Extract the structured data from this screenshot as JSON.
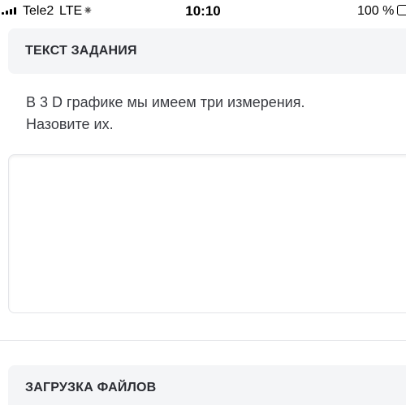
{
  "status_bar": {
    "carrier": "Tele2",
    "network": "LTE",
    "loading_glyph": "⁕",
    "time": "10:10",
    "battery": "100 %"
  },
  "task_section": {
    "header": "ТЕКСТ ЗАДАНИЯ",
    "line1": "В 3 D графике мы имеем три измерения.",
    "line2": "Назовите их."
  },
  "answer": {
    "value": ""
  },
  "files_section": {
    "header": "ЗАГРУЗКА ФАЙЛОВ"
  },
  "colors": {
    "header_bg": "#f4f5f7",
    "header_text": "#2b2d33",
    "body_text": "#3a3c42",
    "border": "#e3e4e8"
  }
}
